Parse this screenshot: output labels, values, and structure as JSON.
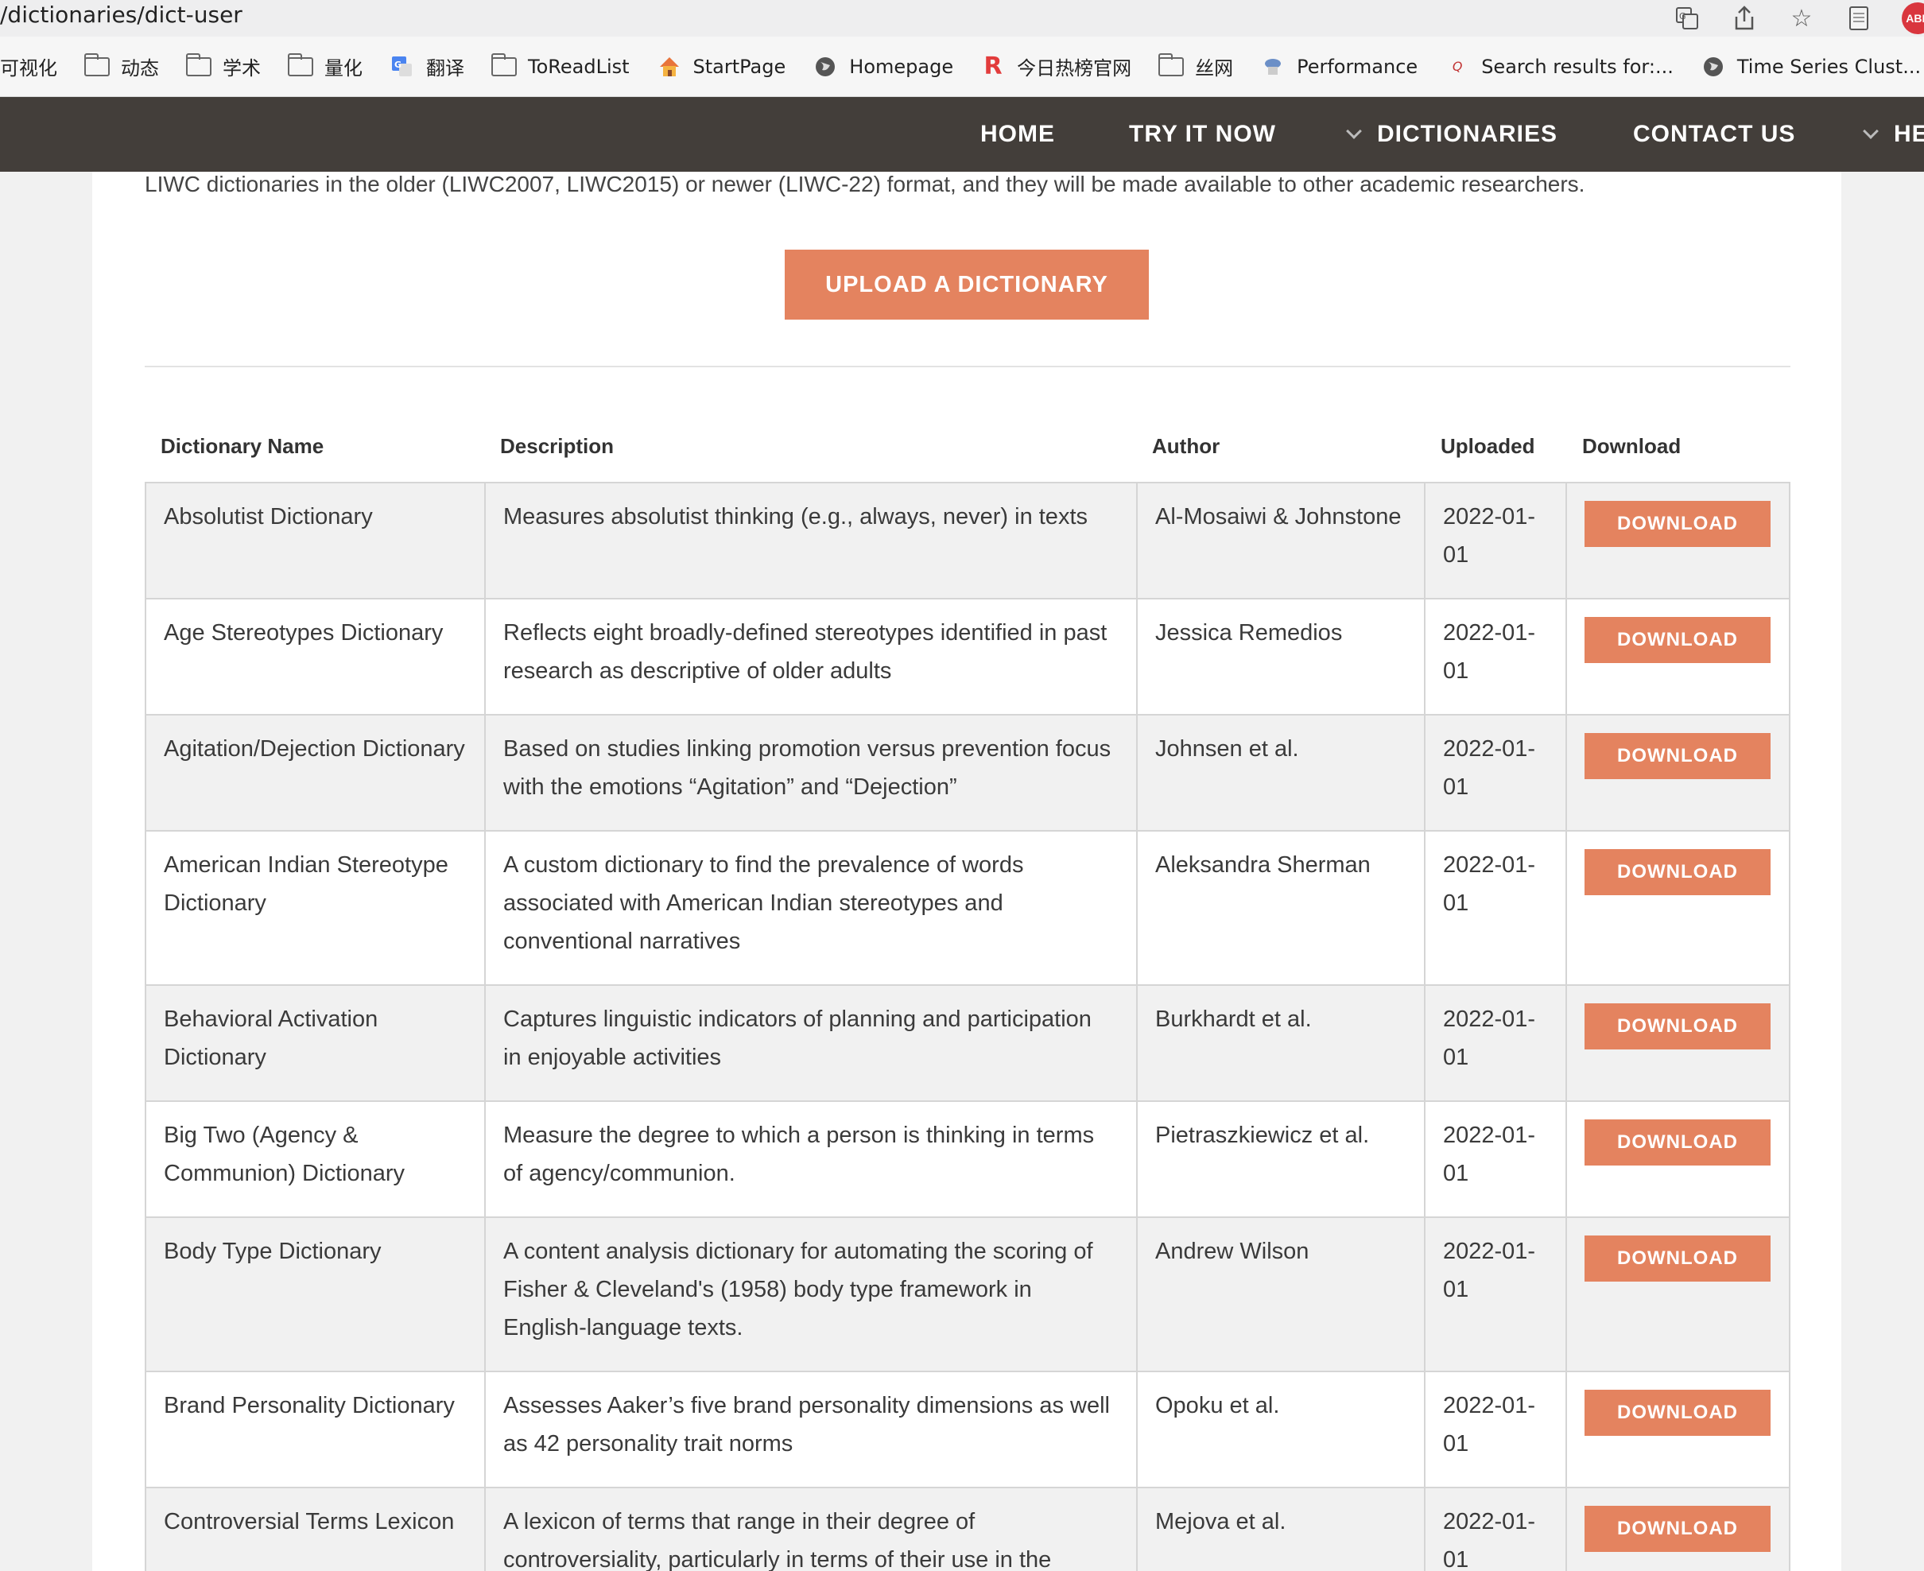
{
  "browser": {
    "url": "/dictionaries/dict-user",
    "bookmarks": [
      {
        "label": "可视化",
        "icon": "none"
      },
      {
        "label": "动态",
        "icon": "folder-icon"
      },
      {
        "label": "学术",
        "icon": "folder-icon"
      },
      {
        "label": "量化",
        "icon": "folder-icon"
      },
      {
        "label": "翻译",
        "icon": "google-translate-icon"
      },
      {
        "label": "ToReadList",
        "icon": "folder-icon"
      },
      {
        "label": "StartPage",
        "icon": "house-icon"
      },
      {
        "label": "Homepage",
        "icon": "globe-icon"
      },
      {
        "label": "今日热榜官网",
        "icon": "r-logo-icon"
      },
      {
        "label": "丝网",
        "icon": "folder-icon"
      },
      {
        "label": "Performance",
        "icon": "site-icon"
      },
      {
        "label": "Search results for:...",
        "icon": "site-icon"
      },
      {
        "label": "Time Series Clust...",
        "icon": "globe-icon"
      }
    ],
    "abp_badge": "ABP"
  },
  "nav": {
    "home": "HOME",
    "try": "TRY IT NOW",
    "dictionaries": "DICTIONARIES",
    "contact": "CONTACT US",
    "help": "HE"
  },
  "intro_text": "LIWC dictionaries in the older (LIWC2007, LIWC2015) or newer (LIWC-22) format, and they will be made available to other academic researchers.",
  "upload_label": "UPLOAD A DICTIONARY",
  "table": {
    "headers": {
      "name": "Dictionary Name",
      "description": "Description",
      "author": "Author",
      "uploaded": "Uploaded",
      "download": "Download"
    },
    "download_label": "DOWNLOAD",
    "rows": [
      {
        "name": "Absolutist Dictionary",
        "description": "Measures absolutist thinking (e.g., always, never) in texts",
        "author": "Al-Mosaiwi & Johnstone",
        "uploaded": "2022-01-01"
      },
      {
        "name": "Age Stereotypes Dictionary",
        "description": "Reflects eight broadly-defined stereotypes identified in past research as descriptive of older adults",
        "author": "Jessica Remedios",
        "uploaded": "2022-01-01"
      },
      {
        "name": "Agitation/Dejection Dictionary",
        "description": "Based on studies linking promotion versus prevention focus with the emotions “Agitation” and “Dejection”",
        "author": "Johnsen et al.",
        "uploaded": "2022-01-01"
      },
      {
        "name": "American Indian Stereotype Dictionary",
        "description": "A custom dictionary to find the prevalence of words associated with American Indian stereotypes and conventional narratives",
        "author": "Aleksandra Sherman",
        "uploaded": "2022-01-01"
      },
      {
        "name": "Behavioral Activation Dictionary",
        "description": "Captures linguistic indicators of planning and participation in enjoyable activities",
        "author": "Burkhardt et al.",
        "uploaded": "2022-01-01"
      },
      {
        "name": "Big Two (Agency & Communion) Dictionary",
        "description": "Measure the degree to which a person is thinking in terms of agency/communion.",
        "author": "Pietraszkiewicz et al.",
        "uploaded": "2022-01-01"
      },
      {
        "name": "Body Type Dictionary",
        "description": "A content analysis dictionary for automating the scoring of Fisher & Cleveland's (1958) body type framework in English-language texts.",
        "author": "Andrew Wilson",
        "uploaded": "2022-01-01"
      },
      {
        "name": "Brand Personality Dictionary",
        "description": "Assesses Aaker’s five brand personality dimensions as well as 42 personality trait norms",
        "author": "Opoku et al.",
        "uploaded": "2022-01-01"
      },
      {
        "name": "Controversial Terms Lexicon",
        "description": "A lexicon of terms that range in their degree of controversiality, particularly in terms of their use in the",
        "author": "Mejova et al.",
        "uploaded": "2022-01-01"
      }
    ]
  },
  "colors": {
    "nav_bg": "#433e3a",
    "accent": "#e4835f",
    "row_shade": "#f1f1f1"
  }
}
